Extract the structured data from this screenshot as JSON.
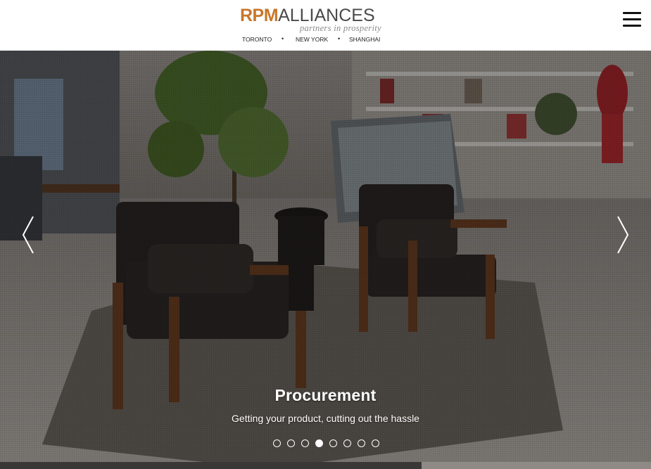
{
  "header": {
    "logo": {
      "brand_part1": "RPM",
      "brand_part2": "ALLIANCES",
      "tagline": "partners in prosperity",
      "cities": [
        "TORONTO",
        "NEW YORK",
        "SHANGHAI"
      ],
      "separator": "•"
    },
    "menu_icon": "hamburger-menu-icon"
  },
  "slider": {
    "title": "Procurement",
    "subtitle": "Getting your product, cutting out the hassle",
    "slide_count": 8,
    "active_slide_index": 3,
    "prev_icon": "chevron-left-icon",
    "next_icon": "chevron-right-icon"
  },
  "colors": {
    "brand_orange": "#c8772a",
    "brand_gray": "#4a4a4a",
    "overlay_text": "#ffffff"
  }
}
